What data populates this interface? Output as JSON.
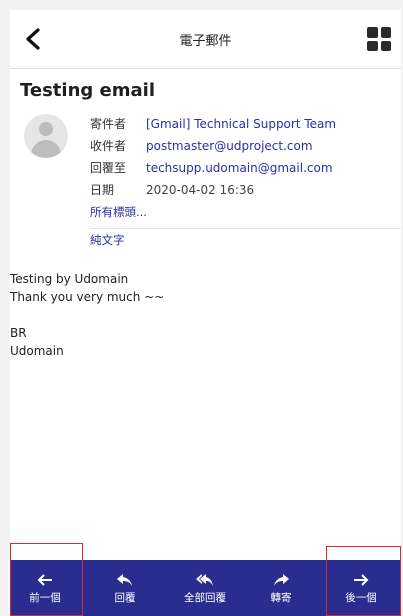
{
  "topbar": {
    "title": "電子郵件",
    "back_icon": "chevron-left-icon",
    "menu_icon": "grid-icon"
  },
  "email": {
    "subject": "Testing email",
    "from_label": "寄件者",
    "from_value": "[Gmail] Technical Support Team",
    "to_label": "收件者",
    "to_value": "postmaster@udproject.com",
    "reply_label": "回覆至",
    "reply_value": "techsupp.udomain@gmail.com",
    "date_label": "日期",
    "date_value": "2020-04-02 16:36",
    "all_headers_link": "所有標頭...",
    "plain_text_link": "純文字",
    "body_lines": [
      "Testing by Udomain",
      "Thank you very much ~~",
      "",
      "BR",
      "Udomain"
    ]
  },
  "bottombar": {
    "items": [
      {
        "label": "前一個",
        "icon": "arrow-left-icon"
      },
      {
        "label": "回覆",
        "icon": "reply-icon"
      },
      {
        "label": "全部回覆",
        "icon": "reply-all-icon"
      },
      {
        "label": "轉寄",
        "icon": "forward-icon"
      },
      {
        "label": "後一個",
        "icon": "arrow-right-icon"
      }
    ]
  },
  "colors": {
    "bottombar_bg": "#2a2d8f",
    "link": "#2b2fa0",
    "highlight_box": "#d62b2b"
  }
}
